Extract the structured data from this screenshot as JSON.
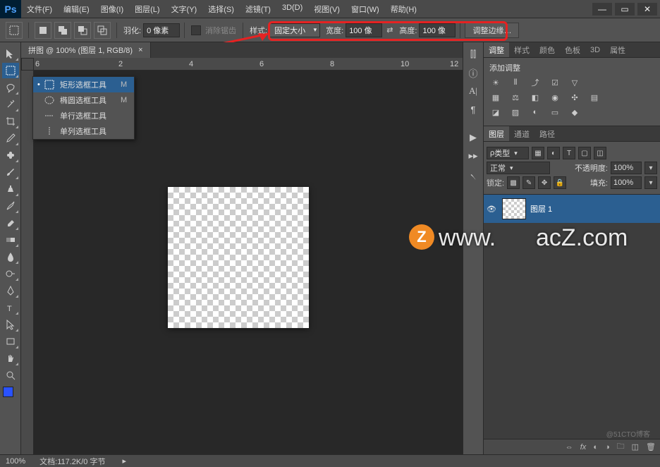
{
  "app": {
    "logo": "Ps"
  },
  "menu": [
    "文件(F)",
    "编辑(E)",
    "图像(I)",
    "图层(L)",
    "文字(Y)",
    "选择(S)",
    "滤镜(T)",
    "3D(D)",
    "视图(V)",
    "窗口(W)",
    "帮助(H)"
  ],
  "options": {
    "feather_label": "羽化:",
    "feather_value": "0 像素",
    "antialias": "消除锯齿",
    "style_label": "样式:",
    "style_value": "固定大小",
    "width_label": "宽度:",
    "width_value": "100 像",
    "height_label": "高度:",
    "height_value": "100 像",
    "refine": "调整边缘…"
  },
  "doc_tab": "拼图 @ 100% (图层 1, RGB/8)",
  "ruler_marks": [
    "6",
    "2",
    "4",
    "6",
    "8",
    "10",
    "12"
  ],
  "flyout": [
    {
      "label": "矩形选框工具",
      "shortcut": "M",
      "sel": true
    },
    {
      "label": "椭圆选框工具",
      "shortcut": "M",
      "sel": false
    },
    {
      "label": "单行选框工具",
      "shortcut": "",
      "sel": false
    },
    {
      "label": "单列选框工具",
      "shortcut": "",
      "sel": false
    }
  ],
  "panels": {
    "top_tabs": [
      "调整",
      "样式",
      "颜色",
      "色板",
      "3D",
      "属性"
    ],
    "add_adjust": "添加调整",
    "layer_tabs": [
      "图层",
      "通道",
      "路径"
    ],
    "kind": "类型",
    "blend": "正常",
    "opacity_label": "不透明度:",
    "opacity_value": "100%",
    "lock_label": "锁定:",
    "fill_label": "填充:",
    "fill_value": "100%",
    "layer_name": "图层 1"
  },
  "status": {
    "zoom": "100%",
    "doc": "文档:117.2K/0 字节"
  },
  "watermark": {
    "left": "www.",
    "right": "acZ.com",
    "z": "Z",
    "corner": "@51CTO博客"
  }
}
